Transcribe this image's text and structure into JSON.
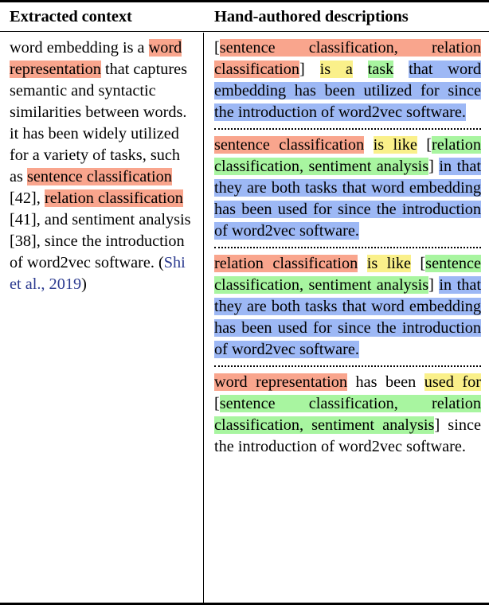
{
  "table": {
    "headers": {
      "left": "Extracted context",
      "right": "Hand-authored descriptions"
    },
    "colors": {
      "red": "#f9a58d",
      "yellow": "#faf08a",
      "green": "#a8f5a0",
      "blue": "#9db8f5",
      "citation": "#2b3a8f"
    },
    "extracted_context": {
      "full_text": "word embedding is a word representation that captures semantic and syntactic similarities between words. it has been widely utilized for a variety of tasks, such as sentence classification [42], relation classification [41], and sentiment analysis [38], since the introduction of word2vec software. (Shi et al., 2019)",
      "segments": [
        {
          "text": "word embedding is a ",
          "hl": "none"
        },
        {
          "text": "word representation",
          "hl": "red"
        },
        {
          "text": " that captures semantic and syntactic similarities between words. it has been widely utilized for a variety of tasks, such as ",
          "hl": "none"
        },
        {
          "text": "sentence classification",
          "hl": "red"
        },
        {
          "text": " [42], ",
          "hl": "none"
        },
        {
          "text": "relation classification",
          "hl": "red"
        },
        {
          "text": " [41], and sentiment analysis [38], since the introduction of word2vec software. ",
          "hl": "none"
        },
        {
          "text": "(",
          "hl": "none"
        },
        {
          "text": "Shi et al., 2019",
          "hl": "citation"
        },
        {
          "text": ")",
          "hl": "none"
        }
      ],
      "citation": "(Shi et al., 2019)"
    },
    "descriptions": [
      {
        "id": "description-1",
        "full_text": "[sentence classification, relation classification] is a task that word embedding has been utilized for since the introduction of word2vec software.",
        "segments": [
          {
            "text": "[",
            "hl": "none"
          },
          {
            "text": "sentence classification, relation classification",
            "hl": "red"
          },
          {
            "text": "]",
            "hl": "none"
          },
          {
            "text": " ",
            "hl": "none"
          },
          {
            "text": "is a",
            "hl": "yellow"
          },
          {
            "text": " ",
            "hl": "none"
          },
          {
            "text": "task",
            "hl": "green"
          },
          {
            "text": " ",
            "hl": "none"
          },
          {
            "text": "that word embedding has been utilized for since the introduction of word2vec software.",
            "hl": "blue"
          }
        ]
      },
      {
        "id": "description-2",
        "full_text": "sentence classification is like [relation classification, sentiment analysis] in that they are both tasks that word embedding has been used for since the introduction of word2vec software.",
        "segments": [
          {
            "text": "sentence classification",
            "hl": "red"
          },
          {
            "text": " ",
            "hl": "none"
          },
          {
            "text": "is like",
            "hl": "yellow"
          },
          {
            "text": " ",
            "hl": "none"
          },
          {
            "text": "[",
            "hl": "none"
          },
          {
            "text": "relation classification, sentiment analysis",
            "hl": "green"
          },
          {
            "text": "]",
            "hl": "none"
          },
          {
            "text": " ",
            "hl": "none"
          },
          {
            "text": "in that they are both tasks that word embedding has been used for since the introduction of word2vec software.",
            "hl": "blue"
          }
        ]
      },
      {
        "id": "description-3",
        "full_text": "relation classification is like [sentence classification, sentiment analysis] in that they are both tasks that word embedding has been used for since the introduction of word2vec software.",
        "segments": [
          {
            "text": "relation classification",
            "hl": "red"
          },
          {
            "text": " ",
            "hl": "none"
          },
          {
            "text": "is like",
            "hl": "yellow"
          },
          {
            "text": " ",
            "hl": "none"
          },
          {
            "text": "[",
            "hl": "none"
          },
          {
            "text": "sentence classification, sentiment analysis",
            "hl": "green"
          },
          {
            "text": "]",
            "hl": "none"
          },
          {
            "text": " ",
            "hl": "none"
          },
          {
            "text": "in that they are both tasks that word embedding has been used for since the introduction of word2vec software.",
            "hl": "blue"
          }
        ]
      },
      {
        "id": "description-4",
        "full_text": "word representation has been used for [sentence classification, relation classification, sentiment analysis] since the introduction of word2vec software.",
        "segments": [
          {
            "text": "word representation",
            "hl": "red"
          },
          {
            "text": " has been ",
            "hl": "none"
          },
          {
            "text": "used for",
            "hl": "yellow"
          },
          {
            "text": " ",
            "hl": "none"
          },
          {
            "text": "[",
            "hl": "none"
          },
          {
            "text": "sentence classification, relation classification, sentiment analysis",
            "hl": "green"
          },
          {
            "text": "]",
            "hl": "none"
          },
          {
            "text": " since the introduction of word2vec software.",
            "hl": "none"
          }
        ]
      }
    ]
  }
}
